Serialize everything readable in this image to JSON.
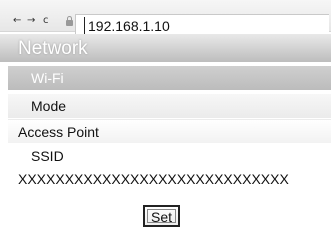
{
  "browser": {
    "back_icon": "←",
    "forward_icon": "→",
    "reload_icon": "c",
    "url": "192.168.1.10"
  },
  "page": {
    "header": "Network",
    "section": "Wi-Fi",
    "mode_label": "Mode",
    "mode_value": "Access Point",
    "ssid_label": "SSID",
    "ssid_value": "XXXXXXXXXXXXXXXXXXXXXXXXXXXXX",
    "set_button": "Set"
  }
}
